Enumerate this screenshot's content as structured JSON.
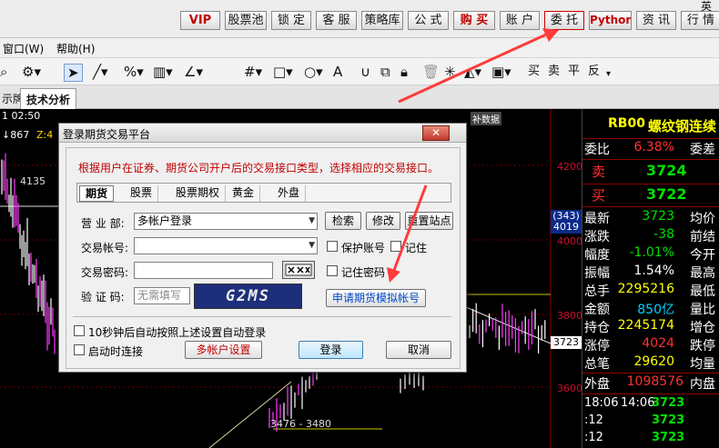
{
  "top_buttons": [
    {
      "label": "VIP",
      "style": "red"
    },
    {
      "label": "股票池",
      "style": "normal"
    },
    {
      "label": "锁 定",
      "style": "normal"
    },
    {
      "label": "客 服",
      "style": "normal"
    },
    {
      "label": "策略库",
      "style": "normal"
    },
    {
      "label": "公 式",
      "style": "normal"
    },
    {
      "label": "购 买",
      "style": "red"
    },
    {
      "label": "账 户",
      "style": "normal"
    },
    {
      "label": "委 托",
      "style": "highlight"
    },
    {
      "label": "Python",
      "style": "red"
    },
    {
      "label": "资 讯",
      "style": "normal"
    },
    {
      "label": "行 情",
      "style": "normal"
    }
  ],
  "ime_label": "英",
  "menu": [
    {
      "label": "窗口(W)"
    },
    {
      "label": "帮助(H)"
    }
  ],
  "toolbar_icons": [
    "magnifier-icon",
    "gear-icon",
    "cursor-icon",
    "line-icon",
    "percent-icon",
    "ruler-icon",
    "angle-icon",
    "grid-icon",
    "rect-icon",
    "circle-icon",
    "text-icon",
    "magnet-icon",
    "copy-icon",
    "lock-icon",
    "delete-icon",
    "settings-icon",
    "save-icon"
  ],
  "toolbar_text": [
    "买",
    "卖",
    "平",
    "反"
  ],
  "tabs": [
    {
      "label": "示牌",
      "active": false
    },
    {
      "label": "技术分析",
      "active": true
    }
  ],
  "chart": {
    "info_time": "1 02:50",
    "info_value": "867",
    "label_z": "Z:4",
    "label_4135": "4135",
    "label_range": "3476 - 3480",
    "bu_shuju": "补数据",
    "price_tag": "3723",
    "blue_box": [
      "(343)",
      "4019"
    ],
    "axis_labels": [
      "4200",
      "4000",
      "3800",
      "3600"
    ]
  },
  "quote": {
    "symbol": "RB00",
    "name": "螺纹钢连续",
    "weibi_label": "委比",
    "weibi_value": "6.38%",
    "weicha_label": "委差",
    "sell_label": "卖",
    "sell_value": "3724",
    "buy_label": "买",
    "buy_value": "3722",
    "rows": [
      {
        "label": "最新",
        "value": "3723",
        "color": "g",
        "right": "均价"
      },
      {
        "label": "涨跌",
        "value": "-38",
        "color": "g",
        "right": "前结"
      },
      {
        "label": "幅度",
        "value": "-1.01%",
        "color": "g",
        "right": "今开"
      },
      {
        "label": "振幅",
        "value": "1.54%",
        "color": "w",
        "right": "最高"
      },
      {
        "label": "总手",
        "value": "2295216",
        "color": "y",
        "right": "最低"
      },
      {
        "label": "金额",
        "value": "850亿",
        "color": "c",
        "right": "量比"
      },
      {
        "label": "持仓",
        "value": "2245174",
        "color": "y",
        "right": "增仓"
      },
      {
        "label": "涨停",
        "value": "4024",
        "color": "r",
        "right": "跌停"
      },
      {
        "label": "总笔",
        "value": "29620",
        "color": "y",
        "right": "均量"
      }
    ],
    "waipan_label": "外盘",
    "waipan_value": "1098576",
    "neipan_label": "内盘",
    "ticks": [
      {
        "time": "18:06",
        "time2": "14:06",
        "value": "3723"
      },
      {
        "time": ":12",
        "time2": "",
        "value": "3723"
      },
      {
        "time": ":12",
        "time2": "",
        "value": "3723"
      }
    ]
  },
  "dialog": {
    "title": "登录期货交易平台",
    "close": "✕",
    "notice": "根据用户在证券、期货公司开户后的交易接口类型，选择相应的交易接口。",
    "tabs": [
      "期货",
      "股票",
      "股票期权",
      "黄金",
      "外盘"
    ],
    "active_tab": "期货",
    "broker_label": "营 业 部:",
    "broker_value": "多帐户登录",
    "account_label": "交易帐号:",
    "account_value": "",
    "password_label": "交易密码:",
    "captcha_label": "验 证 码:",
    "captcha_placeholder": "无需填写",
    "captcha_text": "G2MS",
    "btn_search": "检索",
    "btn_modify": "修改",
    "btn_reset_site": "重置站点",
    "chk_protect": "保护账号",
    "chk_remember": "记住",
    "chk_remember_pwd": "记住密码",
    "btn_apply_sim": "申请期货模拟帐号",
    "chk_auto_login": "10秒钟后自动按照上述设置自动登录",
    "chk_startup": "启动时连接",
    "btn_multi": "多帐户设置",
    "btn_login": "登录",
    "btn_cancel": "取消"
  }
}
